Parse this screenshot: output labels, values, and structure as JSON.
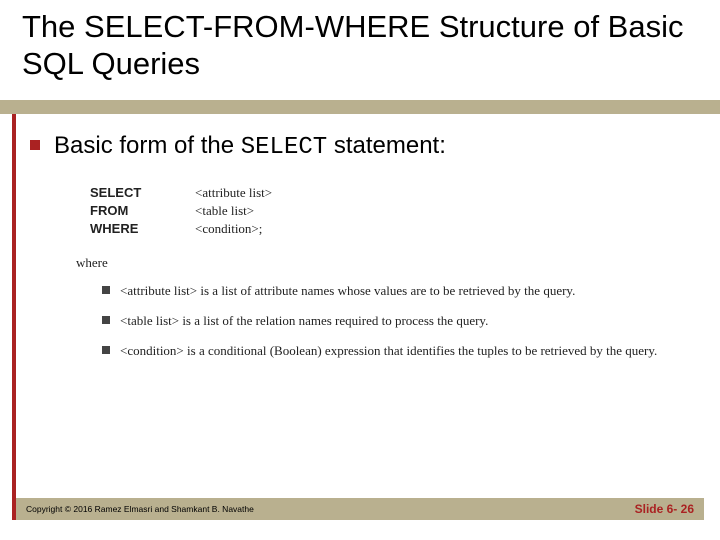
{
  "title": "The SELECT-FROM-WHERE Structure of Basic SQL Queries",
  "bullet": {
    "prefix": "Basic form of the ",
    "code": "SELECT",
    "suffix": " statement:"
  },
  "syntax": {
    "rows": [
      {
        "kw": "SELECT",
        "arg": "<attribute list>"
      },
      {
        "kw": "FROM",
        "arg": "<table list>"
      },
      {
        "kw": "WHERE",
        "arg": "<condition>;"
      }
    ]
  },
  "whereLabel": "where",
  "defs": [
    "<attribute list> is a list of attribute names whose values are to be retrieved by the query.",
    "<table list> is a list of the relation names required to process the query.",
    "<condition> is a conditional (Boolean) expression that identifies the tuples to be retrieved by the query."
  ],
  "footer": {
    "copyright": "Copyright © 2016 Ramez Elmasri and Shamkant B. Navathe",
    "slide": "Slide 6- 26"
  }
}
